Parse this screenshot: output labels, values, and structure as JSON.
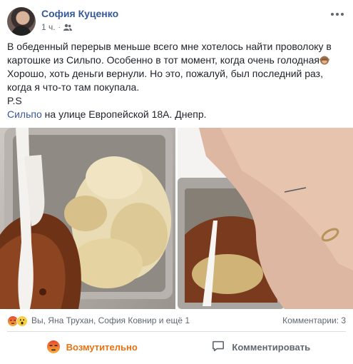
{
  "post": {
    "author": "София Куценко",
    "time": "1 ч.",
    "audience_icon": "friends-icon",
    "text": {
      "line1": "В обеденный перерыв меньше всего мне хотелось найти проволоку в",
      "line2": "картошке из Сильпо. Особенно в тот момент, когда очень голодная",
      "line3": "Хорошо, хоть деньги вернули. Но это, пожалуй, был последний раз,",
      "line4": "когда я что-то там покупала.",
      "line5": "P.S",
      "line6_link": "Сильпо",
      "line6_rest": " на улице Европейской 18А. Днепр."
    }
  },
  "reactions": {
    "icons": [
      "angry-reaction-icon",
      "wow-reaction-icon"
    ],
    "names": "Вы, Яна Трухан, София Ковнир и ещё 1",
    "comments": "Комментарии: 3"
  },
  "actions": {
    "react_label": "Возмутительно",
    "comment_label": "Комментировать"
  },
  "colors": {
    "link": "#365899",
    "angry": "#e9710f",
    "muted": "#606770"
  }
}
